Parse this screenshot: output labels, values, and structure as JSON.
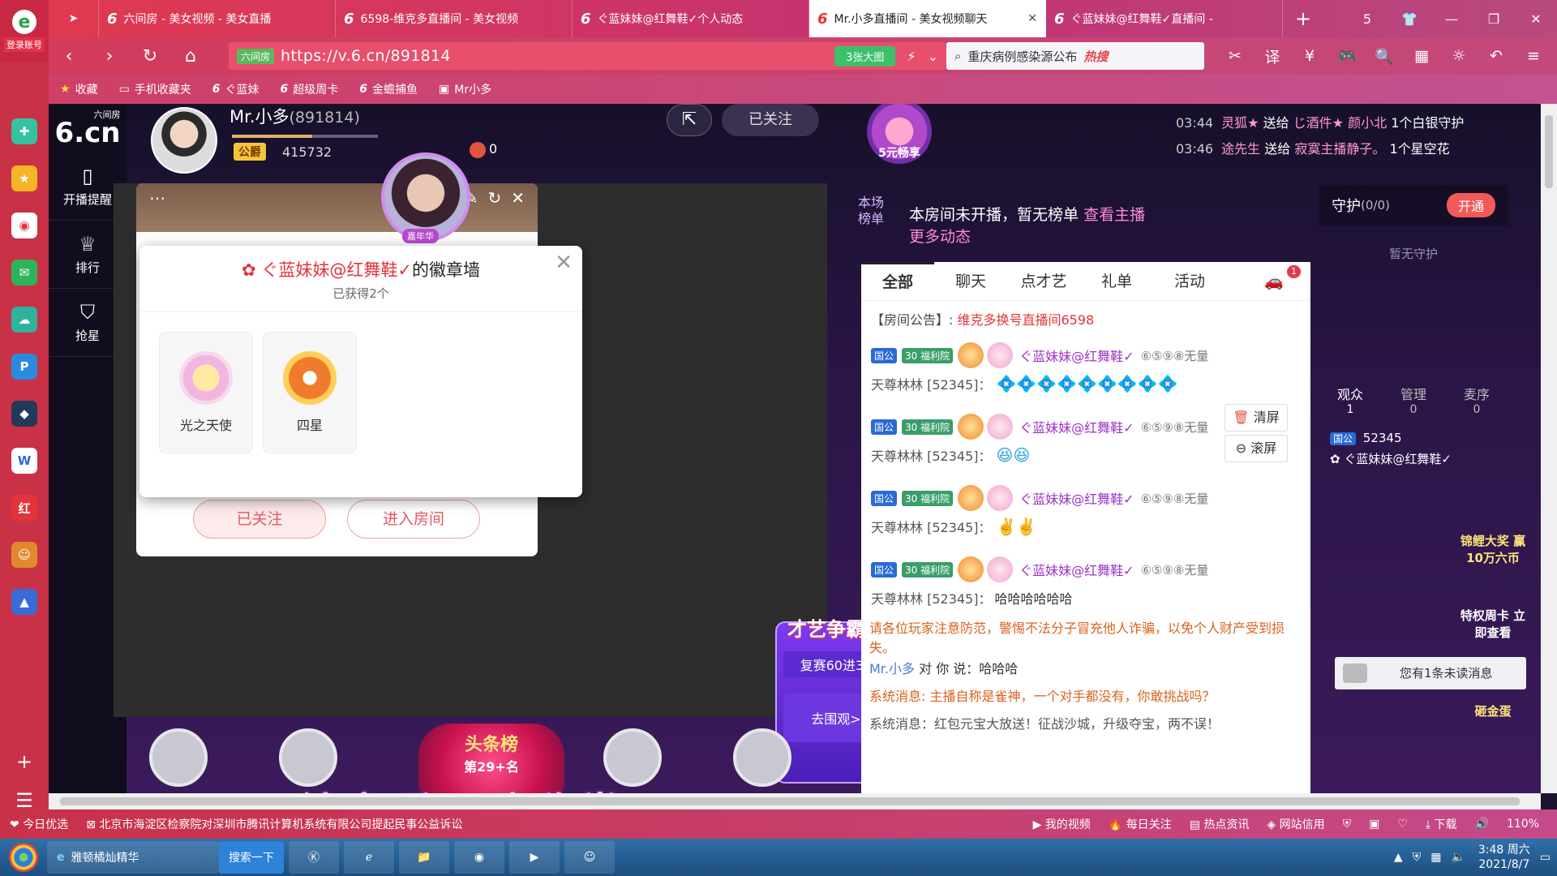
{
  "browser": {
    "brand_label": "登录账号",
    "tabs": [
      {
        "label": "六间房 - 美女视频 - 美女直播"
      },
      {
        "label": "6598-维克多直播间 - 美女视频"
      },
      {
        "label": "ぐ蓝妹妹@红舞鞋✓个人动态"
      },
      {
        "label": "Mr.小多直播间 - 美女视频聊天"
      },
      {
        "label": "ぐ蓝妹妹@红舞鞋✓直播间 -"
      }
    ],
    "tab_count": "5",
    "url_tag": "六间房",
    "url": "https://v.6.cn/891814",
    "big_image_btn": "3张大图",
    "search_text": "重庆病例感染源公布",
    "search_hot": "热搜",
    "bookmarks": [
      "收藏",
      "手机收藏夹",
      "ぐ蓝妹",
      "超级周卡",
      "金蟾捕鱼",
      "Mr小多"
    ]
  },
  "site_nav": {
    "logo_top": "六间房",
    "logo": "6.cn",
    "items": [
      "开播提醒",
      "排行",
      "抢星"
    ]
  },
  "host": {
    "name": "Mr.小多",
    "room_id": "(891814)",
    "badge": "公爵",
    "number": "415732",
    "fire": "0",
    "follow": "已关注",
    "promo": "5元畅享"
  },
  "gift_feed": [
    {
      "time": "03:44",
      "from": "灵狐★",
      "verb": "送给",
      "to": "じ酒件★ 颜小北",
      "gift": "1个白银守护"
    },
    {
      "time": "03:46",
      "from": "途先生",
      "verb": "送给",
      "to": "寂寞主播静子。",
      "gift": "1个星空花"
    }
  ],
  "profile_card": {
    "title": "ぐ蓝妹妹@红舞鞋✓",
    "anchor_tag": "嘉年华",
    "followed": "已关注",
    "enter_room": "进入房间"
  },
  "badge_wall": {
    "owner": "ぐ蓝妹妹@红舞鞋✓",
    "suffix": "的徽章墙",
    "count": "已获得2个",
    "badges": [
      {
        "name": "光之天使"
      },
      {
        "name": "四星"
      }
    ]
  },
  "contest": {
    "title": "才艺争霸赛",
    "round": "复赛60进30",
    "go": "去围观>"
  },
  "seats": [
    "抢座",
    "抢座",
    "",
    "抢座",
    "抢座"
  ],
  "headline": {
    "title": "头条榜",
    "rank": "第29+名"
  },
  "subtitle": "纯音乐，请欣赏",
  "rank_strip": {
    "label1": "本场",
    "label2": "榜单",
    "message": "本房间未开播，暂无榜单",
    "link": "查看主播更多动态"
  },
  "chat": {
    "tabs": [
      "全部",
      "聊天",
      "点才艺",
      "礼单",
      "活动"
    ],
    "car_badge": "1",
    "notice_label": "【房间公告】:",
    "notice_text": "维克多换号直播间6598",
    "messages": [
      {
        "tag1": "国公",
        "tag2": "30 福利院",
        "name": "ぐ蓝妹妹@红舞鞋✓",
        "level": "⑥⑤⑨⑧无量",
        "user": "天尊林林 [52345]：",
        "content": "💠💠💠💠💠💠💠💠💠"
      },
      {
        "tag1": "国公",
        "tag2": "30 福利院",
        "name": "ぐ蓝妹妹@红舞鞋✓",
        "level": "⑥⑤⑨⑧无量",
        "user": "天尊林林 [52345]：",
        "content": "😆😆"
      },
      {
        "tag1": "国公",
        "tag2": "30 福利院",
        "name": "ぐ蓝妹妹@红舞鞋✓",
        "level": "⑥⑤⑨⑧无量",
        "user": "天尊林林 [52345]：",
        "content": "✌️✌️"
      },
      {
        "tag1": "国公",
        "tag2": "30 福利院",
        "name": "ぐ蓝妹妹@红舞鞋✓",
        "level": "⑥⑤⑨⑧无量",
        "user": "天尊林林 [52345]：",
        "content": "哈哈哈哈哈哈"
      }
    ],
    "clear": "清屏",
    "scroll": "滚屏",
    "warning": "请各位玩家注意防范，警惕不法分子冒充他人诈骗，以免个人财产受到损失。",
    "dm_from": "Mr.小多",
    "dm_to": "对 你 说：",
    "dm_text": "哈哈哈",
    "sys1": "系统消息: 主播自称是雀神，一个对手都没有，你敢挑战吗？",
    "sys2": "系统消息：红包元宝大放送！征战沙城，升级夺宝，两不误！"
  },
  "guard": {
    "title": "守护",
    "count": "(0/0)",
    "open": "开通",
    "none": "暂无守护",
    "aud_tabs": [
      {
        "label": "观众",
        "num": "1"
      },
      {
        "label": "管理",
        "num": "0"
      },
      {
        "label": "麦序",
        "num": "0"
      }
    ],
    "aud_user_tag": "国公",
    "aud_user_num": "52345",
    "aud_user_name": "ぐ蓝妹妹@红舞鞋✓",
    "promo1": "锦鲤大奖 赢10万六币",
    "promo2": "特权周卡 立即查看",
    "promo3": "砸金蛋",
    "unread": "您有1条未读消息"
  },
  "status_bar": {
    "left": "今日优选",
    "news": "北京市海淀区检察院对深圳市腾讯计算机系统有限公司提起民事公益诉讼",
    "items": [
      "我的视频",
      "每日关注",
      "热点资讯",
      "网站信用",
      "下载"
    ],
    "zoom": "110%"
  },
  "taskbar": {
    "app1": "雅顿橘灿精华",
    "app1_btn": "搜索一下",
    "time": "3:48 周六",
    "date": "2021/8/7"
  }
}
